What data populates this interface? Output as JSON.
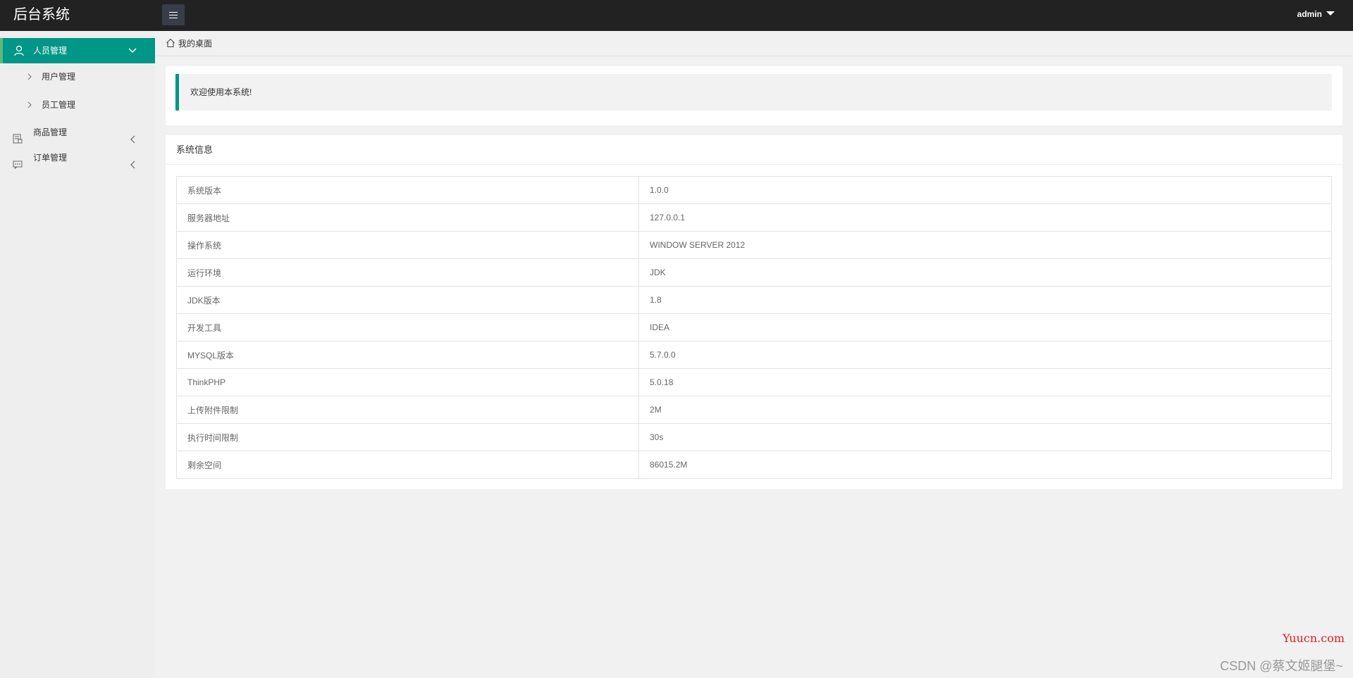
{
  "header": {
    "logo": "后台系统",
    "user": "admin"
  },
  "sidebar": {
    "items": [
      {
        "label": "人员管理",
        "icon": "user-icon",
        "state": "expanded"
      },
      {
        "label": "用户管理",
        "icon": "chevron-right-icon"
      },
      {
        "label": "员工管理",
        "icon": "chevron-right-icon"
      },
      {
        "label": "商品管理",
        "icon": "product-icon",
        "state": "collapsed"
      },
      {
        "label": "订单管理",
        "icon": "order-icon",
        "state": "collapsed"
      }
    ]
  },
  "breadcrumb": {
    "icon": "home-icon",
    "label": "我的桌面"
  },
  "welcome": {
    "message": "欢迎使用本系统!"
  },
  "system_info": {
    "title": "系统信息",
    "rows": [
      {
        "key": "系统版本",
        "value": "1.0.0"
      },
      {
        "key": "服务器地址",
        "value": "127.0.0.1"
      },
      {
        "key": "操作系统",
        "value": "WINDOW SERVER 2012"
      },
      {
        "key": "运行环境",
        "value": "JDK"
      },
      {
        "key": "JDK版本",
        "value": "1.8"
      },
      {
        "key": "开发工具",
        "value": "IDEA"
      },
      {
        "key": "MYSQL版本",
        "value": "5.7.0.0"
      },
      {
        "key": "ThinkPHP",
        "value": "5.0.18"
      },
      {
        "key": "上传附件限制",
        "value": "2M"
      },
      {
        "key": "执行时间限制",
        "value": "30s"
      },
      {
        "key": "剩余空间",
        "value": "86015.2M"
      }
    ]
  },
  "watermarks": {
    "site": "Yuucn.com",
    "author": "CSDN @蔡文姬腿堡~"
  },
  "colors": {
    "header_bg": "#222222",
    "accent": "#009688",
    "sidebar_bg": "#eeeeee",
    "page_bg": "#f1f1f1"
  }
}
